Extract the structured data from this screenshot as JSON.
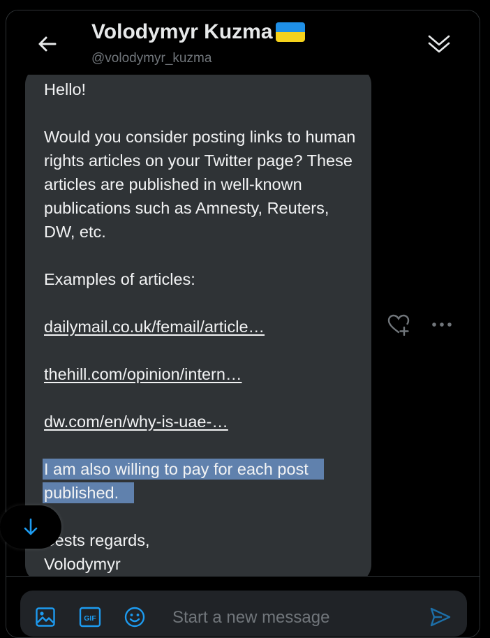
{
  "header": {
    "name": "Volodymyr Kuzma",
    "flag": "ukraine-flag-emoji",
    "handle": "@volodymyr_kuzma"
  },
  "message": {
    "greeting": "Hello!",
    "paragraph1": "Would you consider posting links to human rights articles on your Twitter page? These articles are published in well-known publications such as Amnesty, Reuters, DW, etc.",
    "examples_heading": "Examples of articles:",
    "links": [
      "dailymail.co.uk/femail/article…",
      "thehill.com/opinion/intern…",
      "dw.com/en/why-is-uae-…"
    ],
    "highlighted": "I am also willing to pay for each post published.",
    "closing": "Bests regards,",
    "signature": "Volodymyr"
  },
  "composer": {
    "placeholder": "Start a new message",
    "gif_label": "GIF"
  },
  "colors": {
    "background": "#000000",
    "bubble": "#2f3336",
    "highlight": "#6081ad",
    "accent": "#1d9bf0",
    "muted": "#71767b"
  },
  "icons": {
    "back": "arrow-left-icon",
    "collapse": "double-chevron-down-icon",
    "react": "heart-plus-icon",
    "more": "more-dots-icon",
    "scroll": "arrow-down-icon",
    "media": "image-icon",
    "gif": "gif-icon",
    "emoji": "emoji-icon",
    "send": "send-icon"
  }
}
